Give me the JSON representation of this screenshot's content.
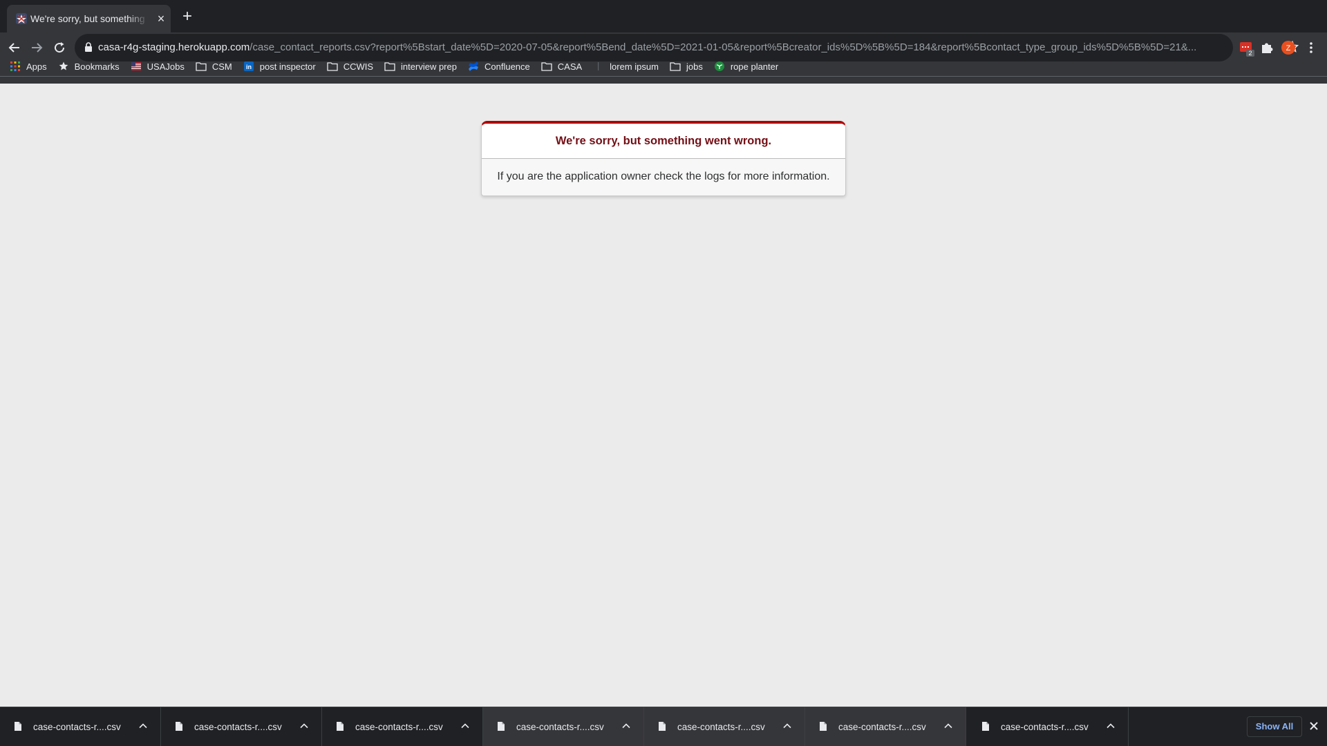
{
  "tab": {
    "title": "We're sorry, but something went wrong"
  },
  "omnibox": {
    "host": "casa-r4g-staging.herokuapp.com",
    "path": "/case_contact_reports.csv?report%5Bstart_date%5D=2020-07-05&report%5Bend_date%5D=2021-01-05&report%5Bcreator_ids%5D%5B%5D=184&report%5Bcontact_type_group_ids%5D%5B%5D=21&..."
  },
  "extensions": {
    "badge_count": "2",
    "profile_initial": "Z"
  },
  "bookmarks": [
    {
      "label": "Apps",
      "icon": "apps-grid-icon"
    },
    {
      "label": "Bookmarks",
      "icon": "star-icon"
    },
    {
      "label": "USAJobs",
      "icon": "usajobs-favicon"
    },
    {
      "label": "CSM",
      "icon": "folder-icon"
    },
    {
      "label": "post inspector",
      "icon": "linkedin-icon"
    },
    {
      "label": "CCWIS",
      "icon": "folder-icon"
    },
    {
      "label": "interview prep",
      "icon": "folder-icon"
    },
    {
      "label": "Confluence",
      "icon": "confluence-icon"
    },
    {
      "label": "CASA",
      "icon": "folder-icon"
    },
    {
      "label": "lorem ipsum",
      "icon": "blank-page-icon"
    },
    {
      "label": "jobs",
      "icon": "folder-icon"
    },
    {
      "label": "rope planter",
      "icon": "plant-favicon"
    }
  ],
  "error": {
    "title": "We're sorry, but something went wrong.",
    "message": "If you are the application owner check the logs for more information."
  },
  "downloads": [
    {
      "name": "case-contacts-r....csv"
    },
    {
      "name": "case-contacts-r....csv"
    },
    {
      "name": "case-contacts-r....csv"
    },
    {
      "name": "case-contacts-r....csv"
    },
    {
      "name": "case-contacts-r....csv"
    },
    {
      "name": "case-contacts-r....csv"
    },
    {
      "name": "case-contacts-r....csv"
    }
  ],
  "shelf": {
    "show_all_label": "Show All"
  },
  "colors": {
    "error_red": "#b00100",
    "error_title": "#730e15",
    "link_blue": "#8ab4f8",
    "profile_orange": "#e8501f"
  }
}
